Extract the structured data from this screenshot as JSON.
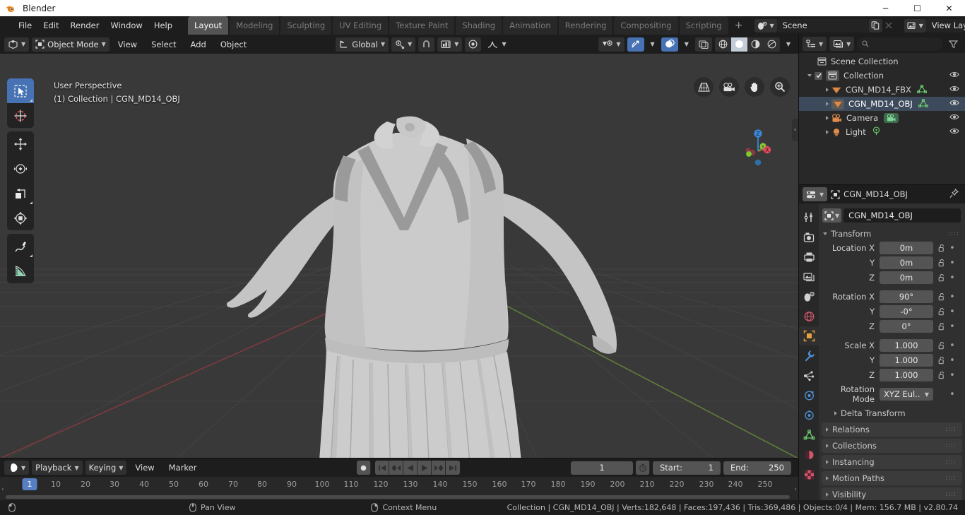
{
  "window": {
    "title": "Blender",
    "logo_icon": "blender-logo-icon",
    "minimize_label": "─",
    "maximize_label": "☐",
    "close_label": "✕"
  },
  "topbar": {
    "app_icon": "blender-icon",
    "menus": [
      "File",
      "Edit",
      "Render",
      "Window",
      "Help"
    ],
    "workspace_tabs": [
      {
        "label": "Layout",
        "active": true
      },
      {
        "label": "Modeling",
        "active": false
      },
      {
        "label": "Sculpting",
        "active": false
      },
      {
        "label": "UV Editing",
        "active": false
      },
      {
        "label": "Texture Paint",
        "active": false
      },
      {
        "label": "Shading",
        "active": false
      },
      {
        "label": "Animation",
        "active": false
      },
      {
        "label": "Rendering",
        "active": false
      },
      {
        "label": "Compositing",
        "active": false
      },
      {
        "label": "Scripting",
        "active": false
      }
    ],
    "add_workspace_label": "+",
    "scene": {
      "browse_icon": "scene-browse-icon",
      "name": "Scene",
      "new_icon": "duplicate-icon",
      "unlink_icon": "close-icon"
    },
    "view_layer": {
      "browse_icon": "viewlayer-browse-icon",
      "name": "View Layer",
      "new_icon": "duplicate-icon",
      "remove_icon": "close-icon"
    }
  },
  "viewport": {
    "header": {
      "editor_type_icon": "editor-type-3dview-icon",
      "mode_icon": "object-mode-icon",
      "mode_label": "Object Mode",
      "menus": [
        "View",
        "Select",
        "Add",
        "Object"
      ],
      "transform_orientation_icon": "orientation-icon",
      "transform_orientation_label": "Global",
      "pivot_icon": "pivot-point-icon",
      "snap_magnet_icon": "snap-magnet-icon",
      "snap_target_icon": "snap-increment-icon",
      "proportional_icon": "proportional-edit-icon",
      "falloff_icon": "smooth-falloff-icon",
      "visibility_icon": "object-visibility-icon",
      "gizmo_icon": "gizmo-icon",
      "overlays_icon": "overlays-icon",
      "xray_icon": "xray-toggle-icon",
      "shading_modes": [
        "wireframe",
        "solid",
        "material-preview",
        "rendered"
      ],
      "shading_active_index": 1
    },
    "overlay_text": {
      "line1": "User Perspective",
      "line2": "(1) Collection | CGN_MD14_OBJ"
    },
    "toolbar": [
      {
        "name": "tweak-select-box-tool",
        "icon": "select-box-icon",
        "active": true,
        "expandable": true
      },
      {
        "name": "cursor-tool",
        "icon": "3d-cursor-icon",
        "active": false,
        "expandable": false
      },
      {
        "name": "move-tool",
        "icon": "move-icon",
        "active": false,
        "expandable": false
      },
      {
        "name": "rotate-tool",
        "icon": "rotate-icon",
        "active": false,
        "expandable": false
      },
      {
        "name": "scale-tool",
        "icon": "scale-icon",
        "active": false,
        "expandable": true
      },
      {
        "name": "transform-tool",
        "icon": "transform-icon",
        "active": false,
        "expandable": false
      },
      {
        "name": "annotate-tool",
        "icon": "annotate-pencil-icon",
        "active": false,
        "expandable": true
      },
      {
        "name": "measure-tool",
        "icon": "measure-ruler-icon",
        "active": false,
        "expandable": false
      }
    ],
    "nav_buttons": [
      {
        "name": "toggle-camera-perspective",
        "icon": "grid-perspective-icon"
      },
      {
        "name": "camera-view",
        "icon": "camera-icon"
      },
      {
        "name": "pan-view",
        "icon": "hand-icon"
      },
      {
        "name": "zoom-view",
        "icon": "magnifier-plus-icon"
      }
    ],
    "gizmo_axes": [
      {
        "label": "Z",
        "color": "#3d87d8"
      },
      {
        "label": "Y",
        "color": "#8cc63f"
      },
      {
        "label": "X",
        "color": "#e04a5c"
      }
    ],
    "sidebar_toggle_icon": "chevron-left-icon",
    "background_color": "#393939",
    "mesh_color": "#cfcfcf"
  },
  "timeline": {
    "editor_type_icon": "editor-type-timeline-icon",
    "menus": [
      "Playback",
      "Keying",
      "View",
      "Marker"
    ],
    "playback_controls": [
      {
        "name": "auto-keying-toggle",
        "icon": "record-dot-icon"
      },
      {
        "name": "jump-to-start-button",
        "icon": "jump-start-icon"
      },
      {
        "name": "jump-prev-keyframe-button",
        "icon": "prev-keyframe-icon"
      },
      {
        "name": "play-reverse-button",
        "icon": "play-reverse-icon"
      },
      {
        "name": "play-button",
        "icon": "play-icon"
      },
      {
        "name": "jump-next-keyframe-button",
        "icon": "next-keyframe-icon"
      },
      {
        "name": "jump-to-end-button",
        "icon": "jump-end-icon"
      }
    ],
    "current_frame": "1",
    "use_preview_range_icon": "stopwatch-icon",
    "start_label": "Start:",
    "start_value": "1",
    "end_label": "End:",
    "end_value": "250",
    "playhead_frame": "1",
    "ruler_ticks": [
      "10",
      "20",
      "30",
      "40",
      "50",
      "60",
      "70",
      "80",
      "90",
      "100",
      "110",
      "120",
      "130",
      "140",
      "150",
      "160",
      "170",
      "180",
      "190",
      "200",
      "210",
      "220",
      "230",
      "240",
      "250"
    ]
  },
  "outliner": {
    "display_mode_icon": "outliner-display-mode-icon",
    "filter_id_icon": "outliner-id-type-icon",
    "search_placeholder": "",
    "search_icon": "search-icon",
    "filter_icon": "filter-funnel-icon",
    "rows": [
      {
        "indent": 0,
        "label": "Scene Collection",
        "icon": "collection-icon",
        "icon_color": "#c0c0c0",
        "expander": "none",
        "checkbox": false,
        "data_icon": "",
        "selected": false,
        "eye": true
      },
      {
        "indent": 1,
        "label": "Collection",
        "icon": "collection-icon",
        "icon_color": "#c0c0c0",
        "expander": "down",
        "checkbox": true,
        "data_icon": "",
        "selected": false,
        "eye": true
      },
      {
        "indent": 2,
        "label": "CGN_MD14_FBX",
        "icon": "mesh-object-icon",
        "icon_color": "#e08b4a",
        "expander": "right",
        "checkbox": false,
        "data_icon": "mesh-data-icon",
        "selected": false,
        "eye": true
      },
      {
        "indent": 2,
        "label": "CGN_MD14_OBJ",
        "icon": "mesh-object-icon",
        "icon_color": "#e08b4a",
        "expander": "right",
        "checkbox": false,
        "data_icon": "mesh-data-icon",
        "selected": true,
        "eye": true
      },
      {
        "indent": 2,
        "label": "Camera",
        "icon": "camera-object-icon",
        "icon_color": "#e08b4a",
        "expander": "right",
        "checkbox": false,
        "data_icon": "camera-data-icon",
        "selected": false,
        "eye": true
      },
      {
        "indent": 2,
        "label": "Light",
        "icon": "light-object-icon",
        "icon_color": "#e08b4a",
        "expander": "right",
        "checkbox": false,
        "data_icon": "light-data-icon",
        "selected": false,
        "eye": true
      }
    ]
  },
  "properties": {
    "editor_type_icon": "editor-type-properties-icon",
    "breadcrumb_icon": "object-icon",
    "breadcrumb_label": "CGN_MD14_OBJ",
    "pin_icon": "pin-icon",
    "tabs": [
      {
        "name": "tool-tab",
        "icon": "tool-icon",
        "active": false
      },
      {
        "name": "render-tab",
        "icon": "render-camera-icon",
        "active": false
      },
      {
        "name": "output-tab",
        "icon": "output-printer-icon",
        "active": false
      },
      {
        "name": "view-layer-tab",
        "icon": "view-layer-images-icon",
        "active": false
      },
      {
        "name": "scene-tab",
        "icon": "scene-cone-icon",
        "active": false
      },
      {
        "name": "world-tab",
        "icon": "world-globe-icon",
        "active": false
      },
      {
        "name": "object-tab",
        "icon": "object-square-icon",
        "active": true
      },
      {
        "name": "modifiers-tab",
        "icon": "wrench-icon",
        "active": false
      },
      {
        "name": "particles-tab",
        "icon": "particles-icon",
        "active": false
      },
      {
        "name": "physics-tab",
        "icon": "physics-orbit-icon",
        "active": false
      },
      {
        "name": "constraints-tab",
        "icon": "constraints-icon",
        "active": false
      },
      {
        "name": "data-tab",
        "icon": "mesh-data-triangle-icon",
        "active": false
      },
      {
        "name": "material-tab",
        "icon": "material-sphere-icon",
        "active": false
      },
      {
        "name": "texture-tab",
        "icon": "texture-checker-icon",
        "active": false
      }
    ],
    "object_name_icon": "object-icon",
    "object_name": "CGN_MD14_OBJ",
    "transform_panel": {
      "title": "Transform",
      "expanded": true,
      "fields": [
        {
          "label": "Location X",
          "value": "0m",
          "locked": false
        },
        {
          "label": "Y",
          "value": "0m",
          "locked": false
        },
        {
          "label": "Z",
          "value": "0m",
          "locked": false
        },
        {
          "label": "Rotation X",
          "value": "90°",
          "locked": false,
          "gap": true
        },
        {
          "label": "Y",
          "value": "-0°",
          "locked": false
        },
        {
          "label": "Z",
          "value": "0°",
          "locked": false
        },
        {
          "label": "Scale X",
          "value": "1.000",
          "locked": false,
          "gap": true
        },
        {
          "label": "Y",
          "value": "1.000",
          "locked": false
        },
        {
          "label": "Z",
          "value": "1.000",
          "locked": false
        }
      ],
      "rotation_mode_label": "Rotation Mode",
      "rotation_mode_value": "XYZ Eul..",
      "delta_transform_label": "Delta Transform"
    },
    "collapsed_panels": [
      "Relations",
      "Collections",
      "Instancing",
      "Motion Paths",
      "Visibility"
    ]
  },
  "statusbar": {
    "mouse_hints": [
      {
        "icon": "mouse-left-icon",
        "label": ""
      },
      {
        "icon": "mouse-middle-icon",
        "label": "Pan View"
      },
      {
        "icon": "mouse-right-icon",
        "label": "Context Menu"
      }
    ],
    "stats": "Collection | CGN_MD14_OBJ | Verts:182,648 | Faces:197,436 | Tris:369,486 | Objects:0/4 | Mem: 156.7 MB | v2.80.74"
  }
}
